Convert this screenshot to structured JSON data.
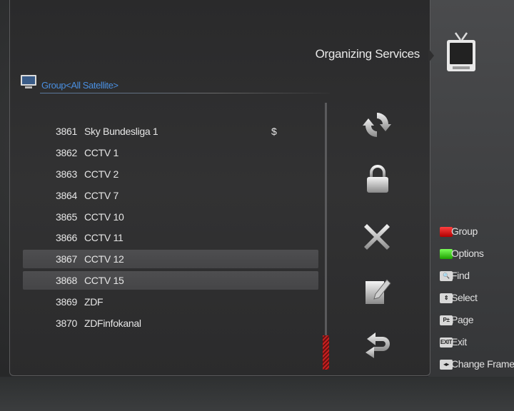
{
  "header": {
    "title": "Organizing Services"
  },
  "group": {
    "label": "Group<All Satellite>"
  },
  "channels": [
    {
      "number": "3861",
      "name": "Sky Bundesliga 1",
      "flag": "$"
    },
    {
      "number": "3862",
      "name": "CCTV 1",
      "flag": ""
    },
    {
      "number": "3863",
      "name": "CCTV 2",
      "flag": ""
    },
    {
      "number": "3864",
      "name": "CCTV 7",
      "flag": ""
    },
    {
      "number": "3865",
      "name": "CCTV 10",
      "flag": ""
    },
    {
      "number": "3866",
      "name": "CCTV 11",
      "flag": ""
    },
    {
      "number": "3867",
      "name": "CCTV 12",
      "flag": "",
      "highlighted": true
    },
    {
      "number": "3868",
      "name": "CCTV 15",
      "flag": "",
      "highlighted": true
    },
    {
      "number": "3869",
      "name": "ZDF",
      "flag": ""
    },
    {
      "number": "3870",
      "name": "ZDFinfokanal",
      "flag": ""
    }
  ],
  "actions": [
    {
      "icon": "move-arrows-icon"
    },
    {
      "icon": "lock-icon"
    },
    {
      "icon": "delete-x-icon"
    },
    {
      "icon": "rename-pencil-icon"
    },
    {
      "icon": "undo-arrow-icon"
    }
  ],
  "legend": {
    "group": {
      "key": "red",
      "label": "Group"
    },
    "options": {
      "key": "green",
      "label": "Options"
    },
    "find": {
      "key": "find-key",
      "label": "Find"
    },
    "select": {
      "key": "updown-key",
      "label": "Select"
    },
    "page": {
      "key": "page-key",
      "label": "Page"
    },
    "exit": {
      "key": "exit-key",
      "label": "Exit"
    },
    "change_frame": {
      "key": "leftright-key",
      "label": "Change Frame"
    }
  },
  "colors": {
    "group_label": "#4a8fe0",
    "scroll_thumb": "#c62020",
    "red_key": "#e01818",
    "green_key": "#3ed01e"
  }
}
